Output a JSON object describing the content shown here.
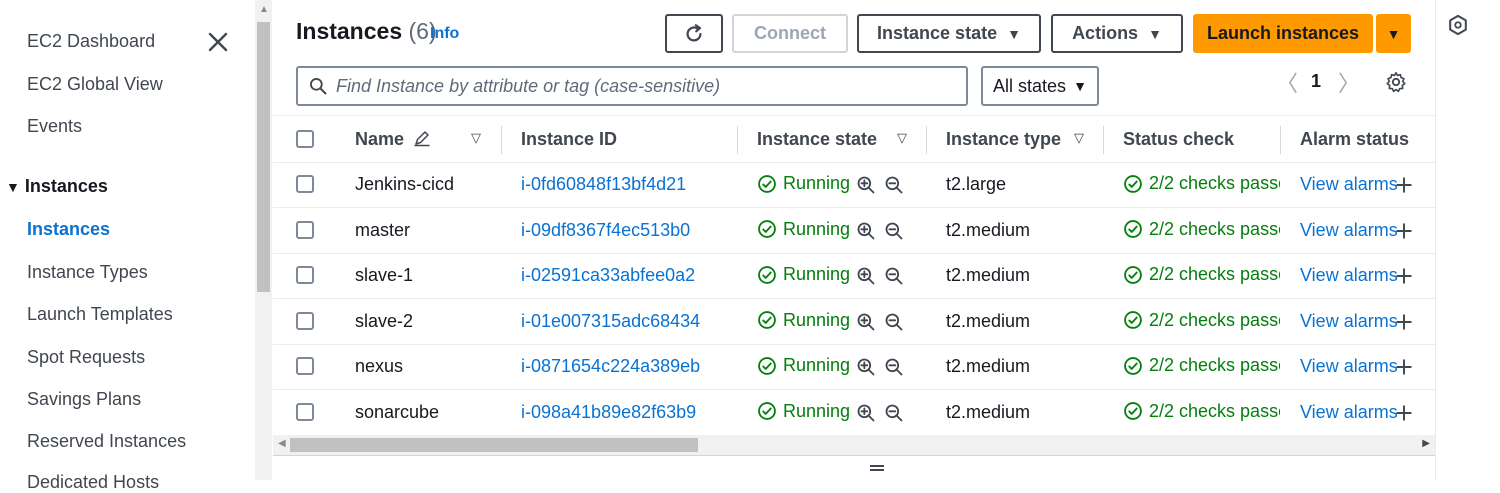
{
  "sidebar": {
    "items": [
      {
        "label": "EC2 Dashboard"
      },
      {
        "label": "EC2 Global View"
      },
      {
        "label": "Events"
      }
    ],
    "section_label": "Instances",
    "sub_items": [
      {
        "label": "Instances",
        "active": true
      },
      {
        "label": "Instance Types"
      },
      {
        "label": "Launch Templates"
      },
      {
        "label": "Spot Requests"
      },
      {
        "label": "Savings Plans"
      },
      {
        "label": "Reserved Instances"
      },
      {
        "label": "Dedicated Hosts"
      }
    ]
  },
  "header": {
    "title": "Instances",
    "count": "(6)",
    "info": "Info",
    "connect_label": "Connect",
    "instance_state_label": "Instance state",
    "actions_label": "Actions",
    "launch_label": "Launch instances"
  },
  "search": {
    "placeholder": "Find Instance by attribute or tag (case-sensitive)",
    "state_filter": "All states"
  },
  "pagination": {
    "page": "1"
  },
  "table": {
    "columns": {
      "name": "Name",
      "instance_id": "Instance ID",
      "instance_state": "Instance state",
      "instance_type": "Instance type",
      "status_check": "Status check",
      "alarm_status": "Alarm status"
    },
    "rows": [
      {
        "name": "Jenkins-cicd",
        "id": "i-0fd60848f13bf4d21",
        "state": "Running",
        "type": "t2.large",
        "check": "2/2 checks passec",
        "alarm": "View alarms"
      },
      {
        "name": "master",
        "id": "i-09df8367f4ec513b0",
        "state": "Running",
        "type": "t2.medium",
        "check": "2/2 checks passec",
        "alarm": "View alarms"
      },
      {
        "name": "slave-1",
        "id": "i-02591ca33abfee0a2",
        "state": "Running",
        "type": "t2.medium",
        "check": "2/2 checks passec",
        "alarm": "View alarms"
      },
      {
        "name": "slave-2",
        "id": "i-01e007315adc68434",
        "state": "Running",
        "type": "t2.medium",
        "check": "2/2 checks passec",
        "alarm": "View alarms"
      },
      {
        "name": "nexus",
        "id": "i-0871654c224a389eb",
        "state": "Running",
        "type": "t2.medium",
        "check": "2/2 checks passec",
        "alarm": "View alarms"
      },
      {
        "name": "sonarcube",
        "id": "i-098a41b89e82f63b9",
        "state": "Running",
        "type": "t2.medium",
        "check": "2/2 checks passec",
        "alarm": "View alarms"
      }
    ]
  },
  "icons": {
    "close": "close-icon",
    "refresh": "refresh-icon",
    "search": "search-icon",
    "settings": "gear-icon",
    "edit": "pencil-icon",
    "zoom_in": "zoom-in-icon",
    "zoom_out": "zoom-out-icon",
    "status_ok": "check-circle-icon",
    "add": "plus-icon",
    "panel": "hexagon-icon"
  },
  "colors": {
    "accent": "#0972d3",
    "primary_button": "#ff9900",
    "success": "#037f0c"
  }
}
